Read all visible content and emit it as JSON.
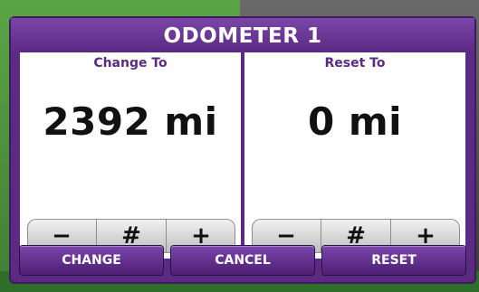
{
  "dialog": {
    "title": "ODOMETER 1",
    "left_panel": {
      "label": "Change To",
      "value": "2392 mi",
      "stepper": {
        "minus": "−",
        "hash": "#",
        "plus": "+"
      }
    },
    "right_panel": {
      "label": "Reset To",
      "value": "0 mi",
      "stepper": {
        "minus": "−",
        "hash": "#",
        "plus": "+"
      }
    },
    "actions": {
      "change": "CHANGE",
      "cancel": "CANCEL",
      "reset": "RESET"
    }
  },
  "colors": {
    "accent": "#5b2a83",
    "panel_bg": "#ffffff",
    "value_text": "#111111"
  }
}
